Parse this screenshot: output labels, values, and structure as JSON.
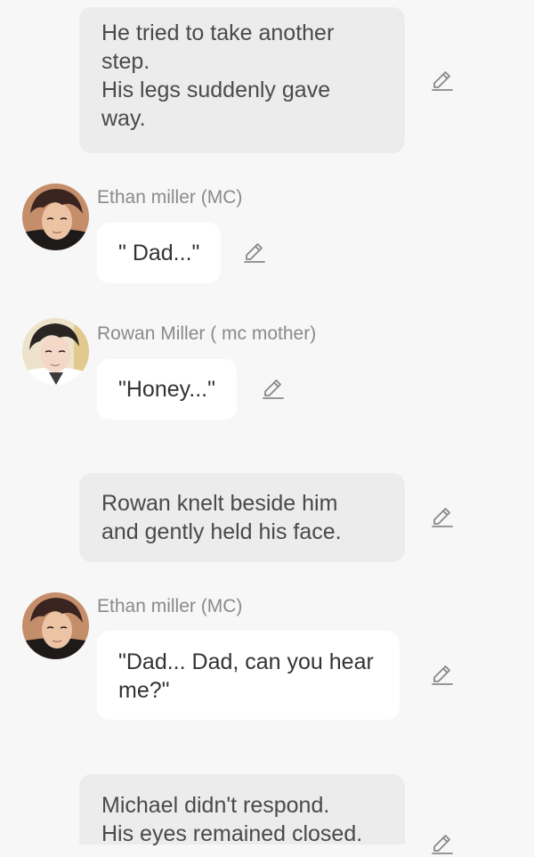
{
  "messages": [
    {
      "type": "narration",
      "lines": [
        "He tried to take another",
        "step.",
        "His legs suddenly gave",
        "way."
      ],
      "edit_icon": "pencil-icon"
    },
    {
      "type": "character",
      "name": "Ethan miller (MC)",
      "lines": [
        "\" Dad...\""
      ],
      "avatar_icon": "ethan-avatar",
      "edit_icon": "pencil-icon"
    },
    {
      "type": "character",
      "name": "Rowan Miller ( mc mother)",
      "lines": [
        "\"Honey...\""
      ],
      "avatar_icon": "rowan-avatar",
      "edit_icon": "pencil-icon"
    },
    {
      "type": "narration",
      "lines": [
        "Rowan knelt beside him",
        "and gently held his face."
      ],
      "edit_icon": "pencil-icon"
    },
    {
      "type": "character",
      "name": "Ethan miller (MC)",
      "lines": [
        "\"Dad... Dad, can you hear",
        "me?\""
      ],
      "avatar_icon": "ethan-avatar",
      "edit_icon": "pencil-icon"
    },
    {
      "type": "narration",
      "lines": [
        "Michael didn't respond.",
        "His eyes remained closed."
      ],
      "edit_icon": "pencil-icon"
    }
  ],
  "colors": {
    "background": "#f7f7f7",
    "narration_bubble": "#ececec",
    "dialogue_bubble": "#ffffff",
    "name_text": "#8a8a8a",
    "icon_stroke": "#888888"
  }
}
